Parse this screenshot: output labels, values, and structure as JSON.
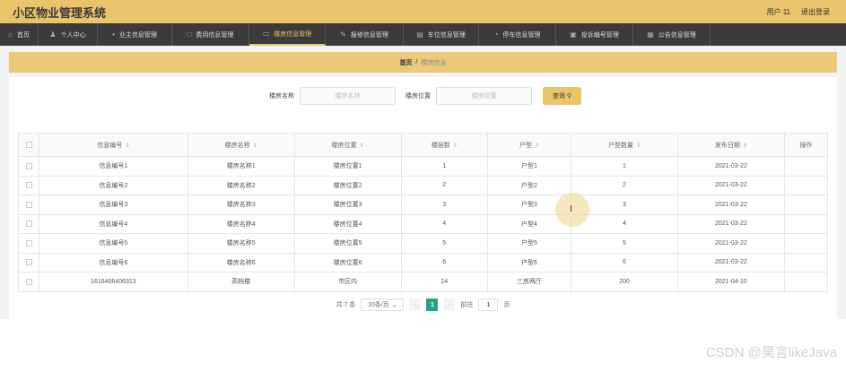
{
  "app": {
    "title": "小区物业管理系统"
  },
  "user": {
    "name": "用户 11",
    "logout": "退出登录"
  },
  "nav": [
    {
      "label": "首页",
      "icon": "home-icon",
      "glyph": "⌂",
      "active": false
    },
    {
      "label": "个人中心",
      "icon": "user-icon",
      "glyph": "♟",
      "active": false
    },
    {
      "label": "业主信息管理",
      "icon": "owner-icon",
      "glyph": "▪",
      "active": false
    },
    {
      "label": "费用信息管理",
      "icon": "fee-icon",
      "glyph": "□",
      "active": false
    },
    {
      "label": "楼房信息管理",
      "icon": "building-icon",
      "glyph": "▭",
      "active": true
    },
    {
      "label": "报修信息管理",
      "icon": "repair-icon",
      "glyph": "✎",
      "active": false
    },
    {
      "label": "车位信息管理",
      "icon": "parking-icon",
      "glyph": "▤",
      "active": false
    },
    {
      "label": "停车信息管理",
      "icon": "car-icon",
      "glyph": "◔",
      "active": false
    },
    {
      "label": "投诉编号管理",
      "icon": "complaint-icon",
      "glyph": "▣",
      "active": false
    },
    {
      "label": "公告信息管理",
      "icon": "notice-icon",
      "glyph": "▦",
      "active": false
    }
  ],
  "breadcrumb": {
    "home": "首页",
    "separator": "/",
    "current": "楼房信息"
  },
  "search": {
    "name_label": "楼房名称",
    "name_placeholder": "楼房名称",
    "location_label": "楼房位置",
    "location_placeholder": "楼房位置",
    "button": "查询"
  },
  "table": {
    "headers": [
      "信息编号",
      "楼房名称",
      "楼房位置",
      "楼层数",
      "户型",
      "户型数量",
      "发布日期",
      "操作"
    ],
    "rows": [
      [
        "信息编号1",
        "楼房名称1",
        "楼房位置1",
        "1",
        "户型1",
        "1",
        "2021-03-22",
        ""
      ],
      [
        "信息编号2",
        "楼房名称2",
        "楼房位置2",
        "2",
        "户型2",
        "2",
        "2021-03-22",
        ""
      ],
      [
        "信息编号3",
        "楼房名称3",
        "楼房位置3",
        "3",
        "户型3",
        "3",
        "2021-03-22",
        ""
      ],
      [
        "信息编号4",
        "楼房名称4",
        "楼房位置4",
        "4",
        "户型4",
        "4",
        "2021-03-22",
        ""
      ],
      [
        "信息编号5",
        "楼房名称5",
        "楼房位置5",
        "5",
        "户型5",
        "5",
        "2021-03-22",
        ""
      ],
      [
        "信息编号6",
        "楼房名称6",
        "楼房位置6",
        "6",
        "户型6",
        "6",
        "2021-03-22",
        ""
      ],
      [
        "1616406406313",
        "高档楼",
        "市区内",
        "24",
        "三房两厅",
        "200",
        "2021-04-10",
        ""
      ]
    ]
  },
  "pagination": {
    "total": "共 7 条",
    "page_size": "10条/页",
    "current_page": "1",
    "goto_label": "前往",
    "goto_value": "1",
    "page_suffix": "页",
    "prev": "‹",
    "next": "›"
  },
  "watermark": "CSDN @昊言likeJava",
  "colors": {
    "accent": "#e9c46a",
    "nav_bg": "#3b3b3b",
    "page_active": "#20a389"
  }
}
